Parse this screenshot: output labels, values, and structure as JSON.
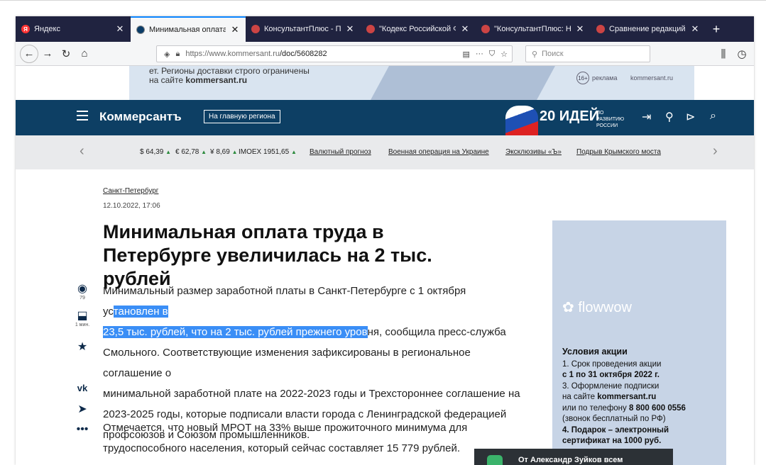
{
  "browser": {
    "tabs": [
      {
        "label": "Яндекс",
        "fav": "Я",
        "color": "#ff3333",
        "active": false
      },
      {
        "label": "Минимальная оплата тру",
        "fav": "",
        "color": "#0a3c67",
        "active": true
      },
      {
        "label": "КонсультантПлюс - Поис",
        "fav": "",
        "color": "#cc4444",
        "active": false
      },
      {
        "label": "\"Кодекс Российской Фед",
        "fav": "",
        "color": "#cc4444",
        "active": false
      },
      {
        "label": "\"КонсультантПлюс: Ново",
        "fav": "",
        "color": "#cc4444",
        "active": false
      },
      {
        "label": "Сравнение редакций док",
        "fav": "",
        "color": "#cc4444",
        "active": false
      }
    ],
    "url_host": "https://www.kommersant.ru",
    "url_path": "/doc/5608282",
    "search_placeholder": "Поиск"
  },
  "ad_banner": {
    "line1": "ет. Регионы доставки строго ограничены",
    "line2_prefix": "на сайте ",
    "line2_bold": "kommersant.ru",
    "age": "16+",
    "ad_label": "реклама",
    "domain": "kommersant.ru"
  },
  "header": {
    "logo": "Коммерсантъ",
    "region_button": "На главную региона",
    "ideas_big": "20 ИДЕЙ",
    "ideas_small": "ПО РАЗВИТИЮ РОССИИ"
  },
  "quotes": {
    "usd": "$ 64,39",
    "eur": "€ 62,78",
    "cny": "¥ 8,69",
    "imoex": "IMOEX 1951,65",
    "links": [
      "Валютный прогноз",
      "Военная операция на Украине",
      "Эксклюзивы «Ъ»",
      "Подрыв Крымского моста"
    ]
  },
  "article": {
    "breadcrumb": "Санкт-Петербург",
    "date": "12.10.2022, 17:06",
    "title": "Минимальная оплата труда в Петербурге увеличилась на 2 тыс. рублей",
    "views": "79",
    "read_time": "1 мин.",
    "p1_l1_a": "Минимальный размер заработной платы в Санкт-Петербурге с 1 октября ус",
    "p1_l1_b": "тановлен в",
    "p1_l2_a": "23,5 тыс. рублей, что на 2 тыс. рублей прежнего уров",
    "p1_l2_b": "ня, сообщила пресс-служба",
    "p1_l3": "Смольного. Соответствующие изменения зафиксированы в региональное соглашение о",
    "p1_l4": "минимальной заработной плате на 2022-2023 годы и Трехстороннее соглашение на",
    "p1_l5": "2023-2025 годы, которые подписали власти города с Ленинградской федерацией",
    "p1_l6": "профсоюзов и Союзом промышленников.",
    "p2_l1": "Отмечается, что новый МРОТ на 33% выше прожиточного минимума для",
    "p2_l2": "трудоспособного населения, который сейчас составляет 15 779 рублей."
  },
  "side_ad": {
    "brand": "flowwow",
    "title": "Условия акции",
    "l1": "1. Срок проведения акции",
    "l2": "с 1 по 31 октября 2022 г.",
    "l3": "3. Оформление подписки",
    "l4_prefix": "на сайте ",
    "l4_bold": "kommersant.ru",
    "l5_prefix": "или по телефону ",
    "l5_bold": "8 800 600 0556",
    "l6": "(звонок бесплатный по РФ)",
    "l7": "4. Подарок – электронный",
    "l8": "сертификат на 1000 руб."
  },
  "toast": {
    "text": "От Александр Зуйков всем"
  }
}
